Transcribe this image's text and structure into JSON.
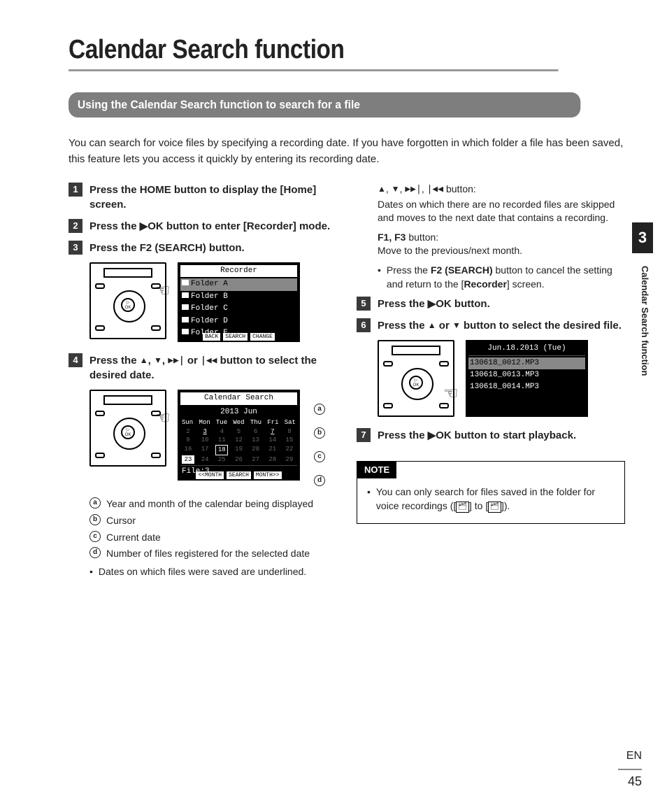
{
  "page_title": "Calendar Search function",
  "section_bar": "Using the Calendar Search function to search for a file",
  "intro": "You can search for voice files by specifying a recording date. If you have forgotten in which folder a file has been saved, this feature lets you access it quickly by entering its recording date.",
  "steps": {
    "s1_pre": "Press the ",
    "s1_b": "HOME",
    "s1_mid": " button to display the [",
    "s1_home": "Home",
    "s1_end": "] screen.",
    "s2_pre": "Press the ",
    "s2_ok": "▶OK",
    "s2_mid": " button to enter [",
    "s2_rec": "Recorder",
    "s2_end": "] mode.",
    "s3_pre": "Press the ",
    "s3_b": "F2 (SEARCH)",
    "s3_end": " button.",
    "s4_pre": "Press the ",
    "s4_or": " or ",
    "s4_end": " button to select the desired date.",
    "s5_pre": "Press the ",
    "s5_ok": "▶OK",
    "s5_end": " button.",
    "s6_pre": "Press the ",
    "s6_or": " or ",
    "s6_end": " button to select the desired file.",
    "s7_pre": "Press the ",
    "s7_ok": "▶OK",
    "s7_end": " button to start playback."
  },
  "lcd1": {
    "title": "Recorder",
    "items": [
      "Folder A",
      "Folder B",
      "Folder C",
      "Folder D",
      "Folder E"
    ],
    "foot": [
      "BACK",
      "SEARCH",
      "CHANGE"
    ]
  },
  "lcd2": {
    "title": "Calendar Search",
    "month": "2013 Jun",
    "days": [
      "Sun",
      "Mon",
      "Tue",
      "Wed",
      "Thu",
      "Fri",
      "Sat"
    ],
    "week2_cells": [
      "2",
      "3",
      "4",
      "5",
      "6",
      "7",
      "8"
    ],
    "cursor_day": "18",
    "current_day": "23",
    "file_label": "File:3",
    "foot": [
      "<<MONTH",
      "SEARCH",
      "MONTH>>"
    ]
  },
  "legend": {
    "a": "Year and month of the calendar being displayed",
    "b": "Cursor",
    "c": "Current date",
    "d": "Number of files registered for the selected date"
  },
  "left_bullets": [
    "Dates on which files were saved are underlined."
  ],
  "right_top": {
    "arrows_label": " button:",
    "arrows_desc": "Dates on which there are no recorded files are skipped and moves to the next date that contains a recording.",
    "f_label": "F1, F3",
    "f_suffix": " button:",
    "f_desc": "Move to the previous/next month.",
    "cancel_pre": "Press the ",
    "cancel_b": "F2 (SEARCH)",
    "cancel_mid": " button to cancel the setting and return to the [",
    "cancel_rec": "Recorder",
    "cancel_end": "] screen."
  },
  "lcd3": {
    "title": "Jun.18.2013 (Tue)",
    "items": [
      "130618_0012.MP3",
      "130618_0013.MP3",
      "130618_0014.MP3"
    ]
  },
  "note": {
    "label": "NOTE",
    "text_pre": "You can only search for files saved in the folder for voice recordings (",
    "badge_a": "A",
    "to": " to ",
    "badge_e": "E",
    "text_end": ")."
  },
  "side": {
    "chapter": "3",
    "label": "Calendar Search function"
  },
  "footer": {
    "lang": "EN",
    "page": "45"
  }
}
